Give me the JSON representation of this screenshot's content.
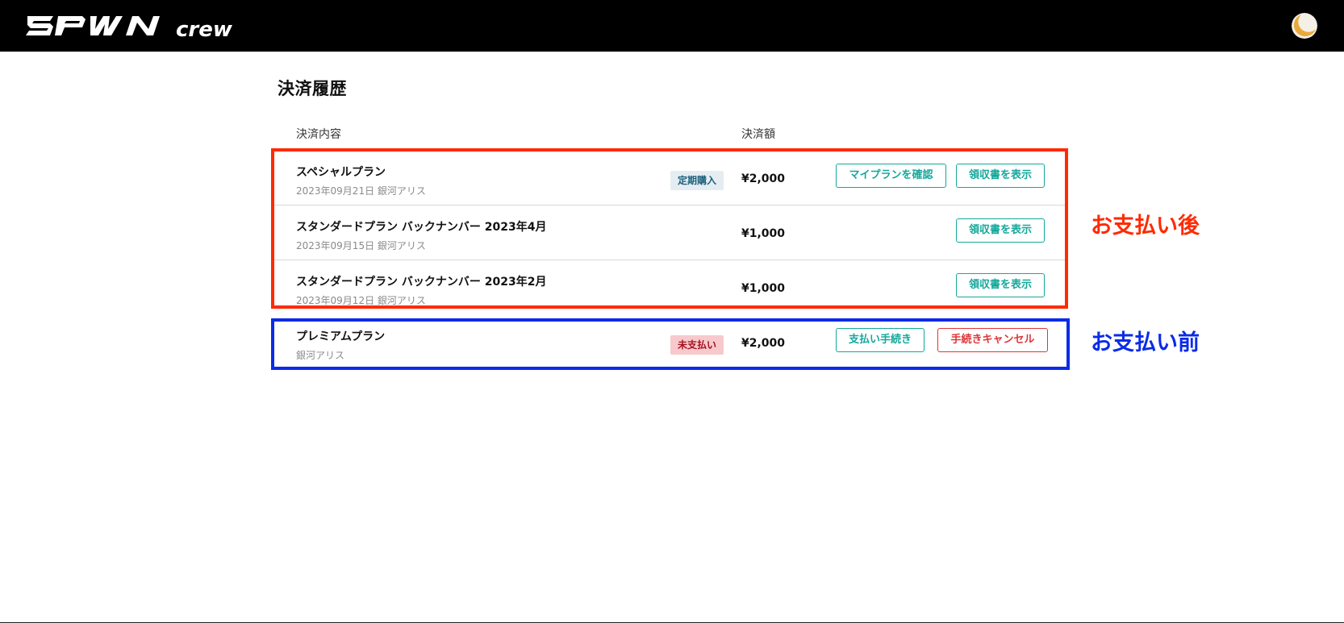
{
  "header": {
    "logo_text": "SPWN",
    "logo_sub": "crew"
  },
  "page": {
    "title": "決済履歴"
  },
  "table": {
    "col_content": "決済内容",
    "col_amount": "決済額"
  },
  "rows": [
    {
      "title": "スペシャルプラン",
      "subtitle": "2023年09月21日 銀河アリス",
      "badge": "定期購入",
      "amount": "¥2,000",
      "buttons": [
        "マイプランを確認",
        "領収書を表示"
      ]
    },
    {
      "title": "スタンダードプラン バックナンバー 2023年4月",
      "subtitle": "2023年09月15日 銀河アリス",
      "amount": "¥1,000",
      "buttons": [
        "領収書を表示"
      ]
    },
    {
      "title": "スタンダードプラン バックナンバー 2023年2月",
      "subtitle": "2023年09月12日 銀河アリス",
      "amount": "¥1,000",
      "buttons": [
        "領収書を表示"
      ]
    },
    {
      "title": "プレミアムプラン",
      "subtitle": "銀河アリス",
      "badge": "未支払い",
      "amount": "¥2,000",
      "buttons": [
        "支払い手続き",
        "手続きキャンセル"
      ]
    }
  ],
  "annotations": {
    "after_payment": "お支払い後",
    "before_payment": "お支払い前"
  },
  "colors": {
    "accent_teal": "#14a89b",
    "cancel_red": "#e03437",
    "annotation_red": "#ff2a00",
    "annotation_blue": "#0a2be8"
  }
}
